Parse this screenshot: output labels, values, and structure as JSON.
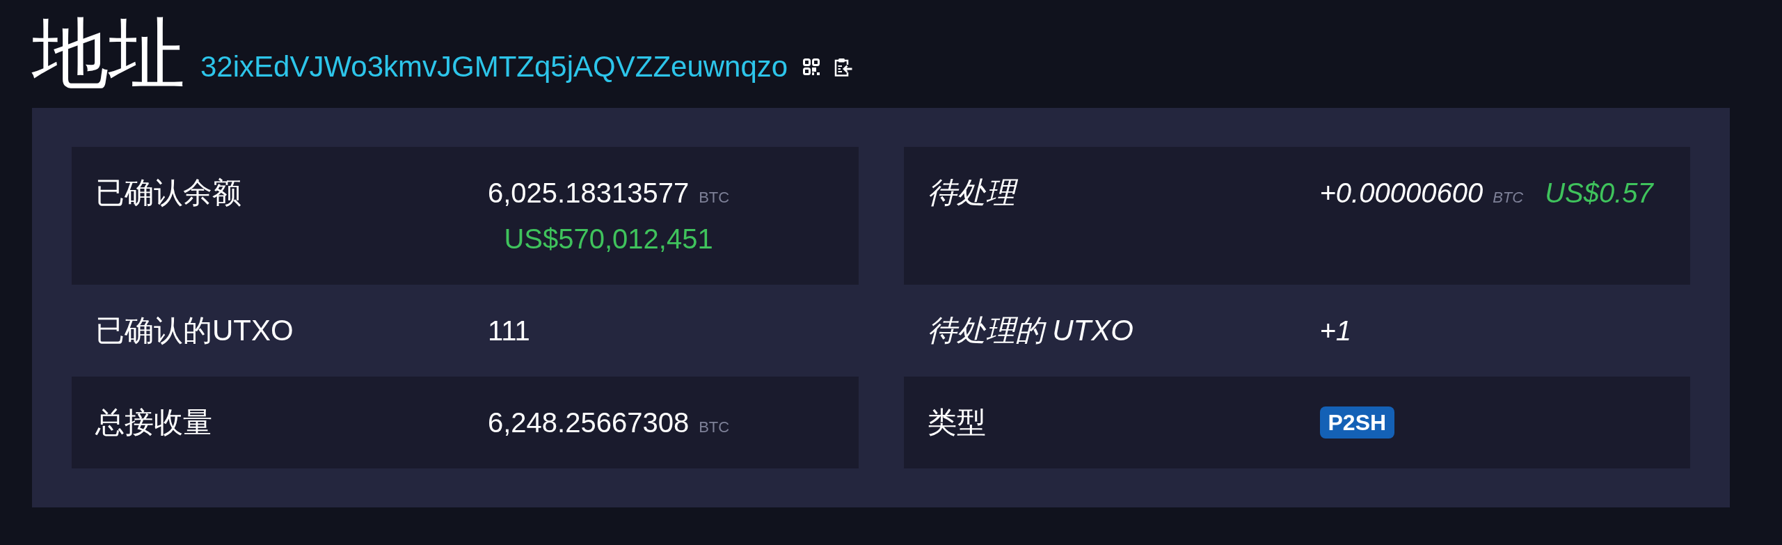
{
  "header": {
    "title": "地址",
    "address": "32ixEdVJWo3kmvJGMTZq5jAQVZZeuwnqzo"
  },
  "tables": [
    {
      "rows": [
        {
          "label": "已确认余额",
          "pending": false,
          "kind": "amount",
          "value": "6,025.18313577",
          "unit": "BTC",
          "fiat": "US$570,012,451",
          "fiat_below": true
        },
        {
          "label": "已确认的UTXO",
          "pending": false,
          "kind": "text",
          "value": "111"
        },
        {
          "label": "总接收量",
          "pending": false,
          "kind": "amount",
          "value": "6,248.25667308",
          "unit": "BTC"
        }
      ]
    },
    {
      "rows": [
        {
          "label": "待处理",
          "pending": true,
          "kind": "amount",
          "value": "+0.00000600",
          "unit": "BTC",
          "fiat": "US$0.57",
          "fiat_below": false
        },
        {
          "label": "待处理的 UTXO",
          "pending": true,
          "kind": "text",
          "value": "+1"
        },
        {
          "label": "类型",
          "pending": false,
          "kind": "badge",
          "value": "P2SH"
        }
      ]
    }
  ]
}
